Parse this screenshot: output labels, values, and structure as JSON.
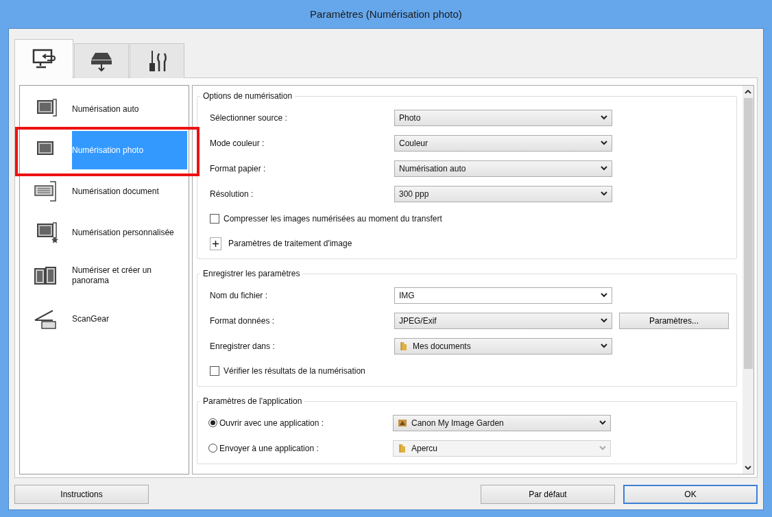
{
  "window": {
    "title": "Paramètres (Numérisation photo)"
  },
  "tabs": [
    {
      "kind": "computer",
      "selected": true
    },
    {
      "kind": "scanner",
      "selected": false
    },
    {
      "kind": "tools",
      "selected": false
    }
  ],
  "sidebar": {
    "items": [
      {
        "kind": "auto",
        "label": "Numérisation auto",
        "selected": false,
        "annotated": false
      },
      {
        "kind": "photo",
        "label": "Numérisation photo",
        "selected": true,
        "annotated": true
      },
      {
        "kind": "document",
        "label": "Numérisation document",
        "selected": false,
        "annotated": false
      },
      {
        "kind": "custom",
        "label": "Numérisation personnalisée",
        "selected": false,
        "annotated": false
      },
      {
        "kind": "panorama",
        "label": "Numériser et créer un panorama",
        "selected": false,
        "annotated": false
      },
      {
        "kind": "scangear",
        "label": "ScanGear",
        "selected": false,
        "annotated": false
      }
    ]
  },
  "groups": [
    {
      "title": "Options de numérisation",
      "rows": [
        {
          "kind": "select",
          "label": "Sélectionner source :",
          "value": "Photo",
          "disabled": false
        },
        {
          "kind": "select",
          "label": "Mode couleur :",
          "value": "Couleur",
          "disabled": false
        },
        {
          "kind": "select",
          "label": "Format papier :",
          "value": "Numérisation auto",
          "disabled": false
        },
        {
          "kind": "select",
          "label": "Résolution :",
          "value": "300 ppp",
          "disabled": false
        },
        {
          "kind": "checkbox",
          "label": "Compresser les images numérisées au moment du transfert",
          "checked": false
        },
        {
          "kind": "expander",
          "label": "Paramètres de traitement d'image",
          "expanded": false
        }
      ]
    },
    {
      "title": "Enregistrer les paramètres",
      "rows": [
        {
          "kind": "select",
          "label": "Nom du fichier :",
          "value": "IMG",
          "disabled": false,
          "editable": true
        },
        {
          "kind": "select",
          "label": "Format données :",
          "value": "JPEG/Exif",
          "disabled": false,
          "button": "Paramètres..."
        },
        {
          "kind": "select",
          "label": "Enregistrer dans :",
          "value": "Mes documents",
          "disabled": false,
          "value_icon": {
            "kind": "folder"
          }
        },
        {
          "kind": "checkbox",
          "label": "Vérifier les résultats de la numérisation",
          "checked": false
        }
      ]
    },
    {
      "title": "Paramètres de l'application",
      "rows": [
        {
          "kind": "radio",
          "label": "Ouvrir avec une application :",
          "selected": true,
          "value": "Canon My Image Garden",
          "disabled": false,
          "value_icon": {
            "kind": "app"
          }
        },
        {
          "kind": "radio",
          "label": "Envoyer à une application :",
          "selected": false,
          "value": "Apercu",
          "disabled": true,
          "value_icon": {
            "kind": "folder"
          }
        }
      ]
    }
  ],
  "buttons": [
    {
      "label": "Instructions",
      "default": false
    },
    {
      "label": "Par défaut",
      "default": false
    },
    {
      "label": "OK",
      "default": true
    }
  ]
}
